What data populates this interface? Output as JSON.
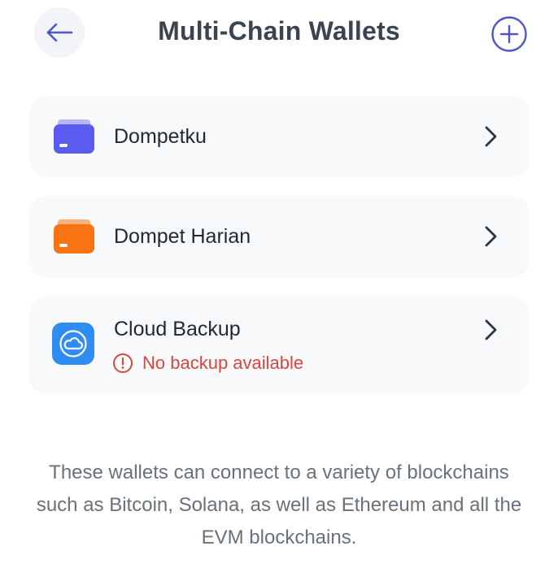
{
  "header": {
    "title": "Multi-Chain Wallets",
    "back_icon": "arrow-left-icon",
    "add_icon": "plus-circle-icon"
  },
  "wallets": [
    {
      "label": "Dompetku",
      "icon": "wallet-icon",
      "color": "#5b5bf0"
    },
    {
      "label": "Dompet Harian",
      "icon": "wallet-icon",
      "color": "#f77314"
    }
  ],
  "backup": {
    "label": "Cloud Backup",
    "icon": "cloud-icon",
    "status": "No backup available",
    "status_icon": "alert-circle-icon",
    "status_color": "#d8463f"
  },
  "footer": {
    "description": "These wallets can connect to a variety of blockchains such as Bitcoin, Solana, as well as Ethereum and all the EVM blockchains."
  },
  "colors": {
    "accent": "#4f56c8",
    "card_background": "#f8f9fb",
    "cloud_blue": "#2f8cf2"
  }
}
